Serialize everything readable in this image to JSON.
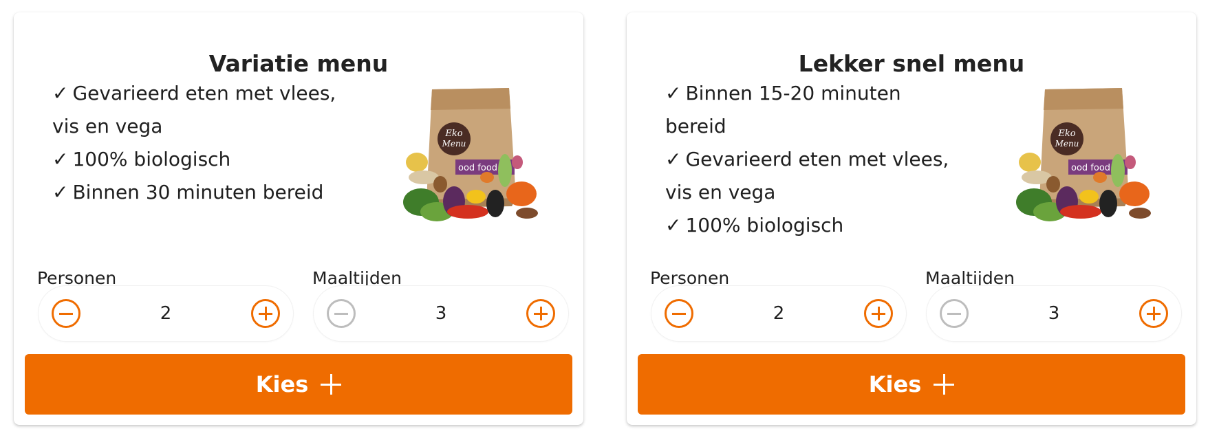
{
  "cards": [
    {
      "title": "Variatie menu",
      "features": [
        {
          "check": "✓",
          "text": "Gevarieerd eten met vlees, vis en vega"
        },
        {
          "check": "✓",
          "text": "100% biologisch"
        },
        {
          "check": "✓",
          "text": "Binnen 30 minuten bereid"
        }
      ],
      "image": {
        "brand_line1": "Eko",
        "brand_line2": "Menu",
        "tagline": "ood food"
      },
      "persons": {
        "label": "Personen",
        "value": "2"
      },
      "meals": {
        "label": "Maaltijden",
        "value": "3"
      },
      "button_label": "Kies"
    },
    {
      "title": "Lekker snel menu",
      "features": [
        {
          "check": "✓",
          "text": "Binnen 15-20 minuten bereid"
        },
        {
          "check": "✓",
          "text": "Gevarieerd eten met vlees, vis en vega"
        },
        {
          "check": "✓",
          "text": "100% biologisch"
        }
      ],
      "image": {
        "brand_line1": "Eko",
        "brand_line2": "Menu",
        "tagline": "ood food"
      },
      "persons": {
        "label": "Personen",
        "value": "2"
      },
      "meals": {
        "label": "Maaltijden",
        "value": "3"
      },
      "button_label": "Kies"
    }
  ],
  "icons": {
    "minus": "minus-circle-icon",
    "plus": "plus-circle-icon",
    "add": "plus-icon",
    "check": "checkmark-icon"
  },
  "colors": {
    "accent": "#ef6c00",
    "disabled": "#bdbdbd",
    "text": "#1f1f1f",
    "card_bg": "#ffffff"
  }
}
